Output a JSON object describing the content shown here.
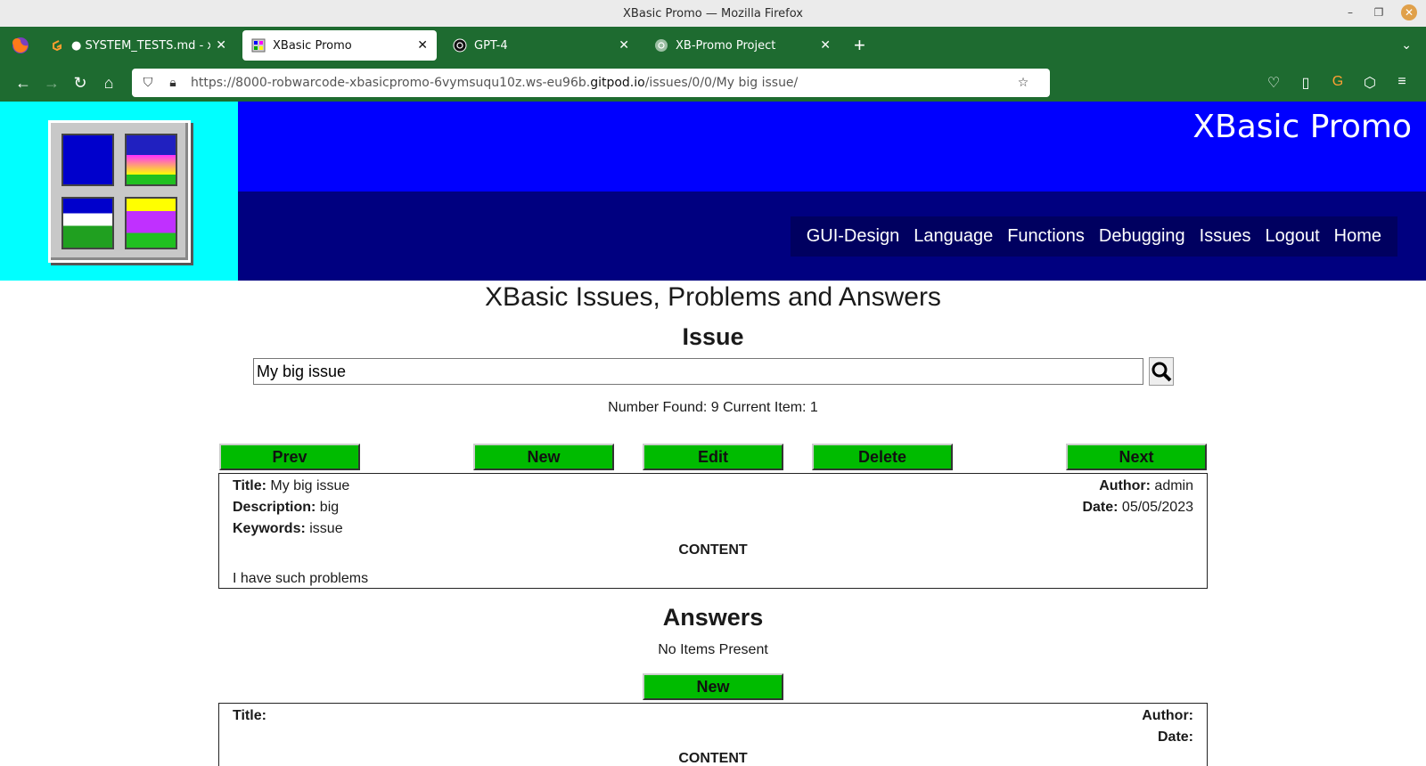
{
  "window": {
    "title": "XBasic Promo — Mozilla Firefox"
  },
  "tabs": [
    {
      "label": "● SYSTEM_TESTS.md - xbas",
      "active": false
    },
    {
      "label": "XBasic Promo",
      "active": true
    },
    {
      "label": "GPT-4",
      "active": false
    },
    {
      "label": "XB-Promo Project",
      "active": false
    }
  ],
  "urlbar": {
    "url_prefix": "https://8000-robwarcode-xbasicpromo-6vymsuqu10z.ws-eu96b.",
    "url_domain": "gitpod.io",
    "url_path": "/issues/0/0/My big issue/"
  },
  "site": {
    "title": "XBasic Promo",
    "menu": [
      "GUI-Design",
      "Language",
      "Functions",
      "Debugging",
      "Issues",
      "Logout",
      "Home"
    ]
  },
  "page": {
    "heading": "XBasic Issues, Problems and Answers",
    "section": "Issue",
    "search_value": "My big issue",
    "found_text": "Number Found: 9 Current Item: 1",
    "buttons": {
      "prev": "Prev",
      "new": "New",
      "edit": "Edit",
      "delete": "Delete",
      "next": "Next"
    }
  },
  "issue": {
    "title_label": "Title:",
    "title": "My big issue",
    "author_label": "Author:",
    "author": "admin",
    "description_label": "Description:",
    "description": "big",
    "date_label": "Date:",
    "date": "05/05/2023",
    "keywords_label": "Keywords:",
    "keywords": "issue",
    "content_label": "CONTENT",
    "content": "I have such problems"
  },
  "answers": {
    "heading": "Answers",
    "empty_text": "No Items Present",
    "new_label": "New",
    "title_label": "Title:",
    "author_label": "Author:",
    "date_label": "Date:",
    "content_label": "CONTENT"
  },
  "colors": {
    "button_green": "#00bb00",
    "header_blue": "#0000ff",
    "header_navy": "#000080",
    "logo_cyan": "#00ffff",
    "browser_green": "#1e6b30"
  }
}
